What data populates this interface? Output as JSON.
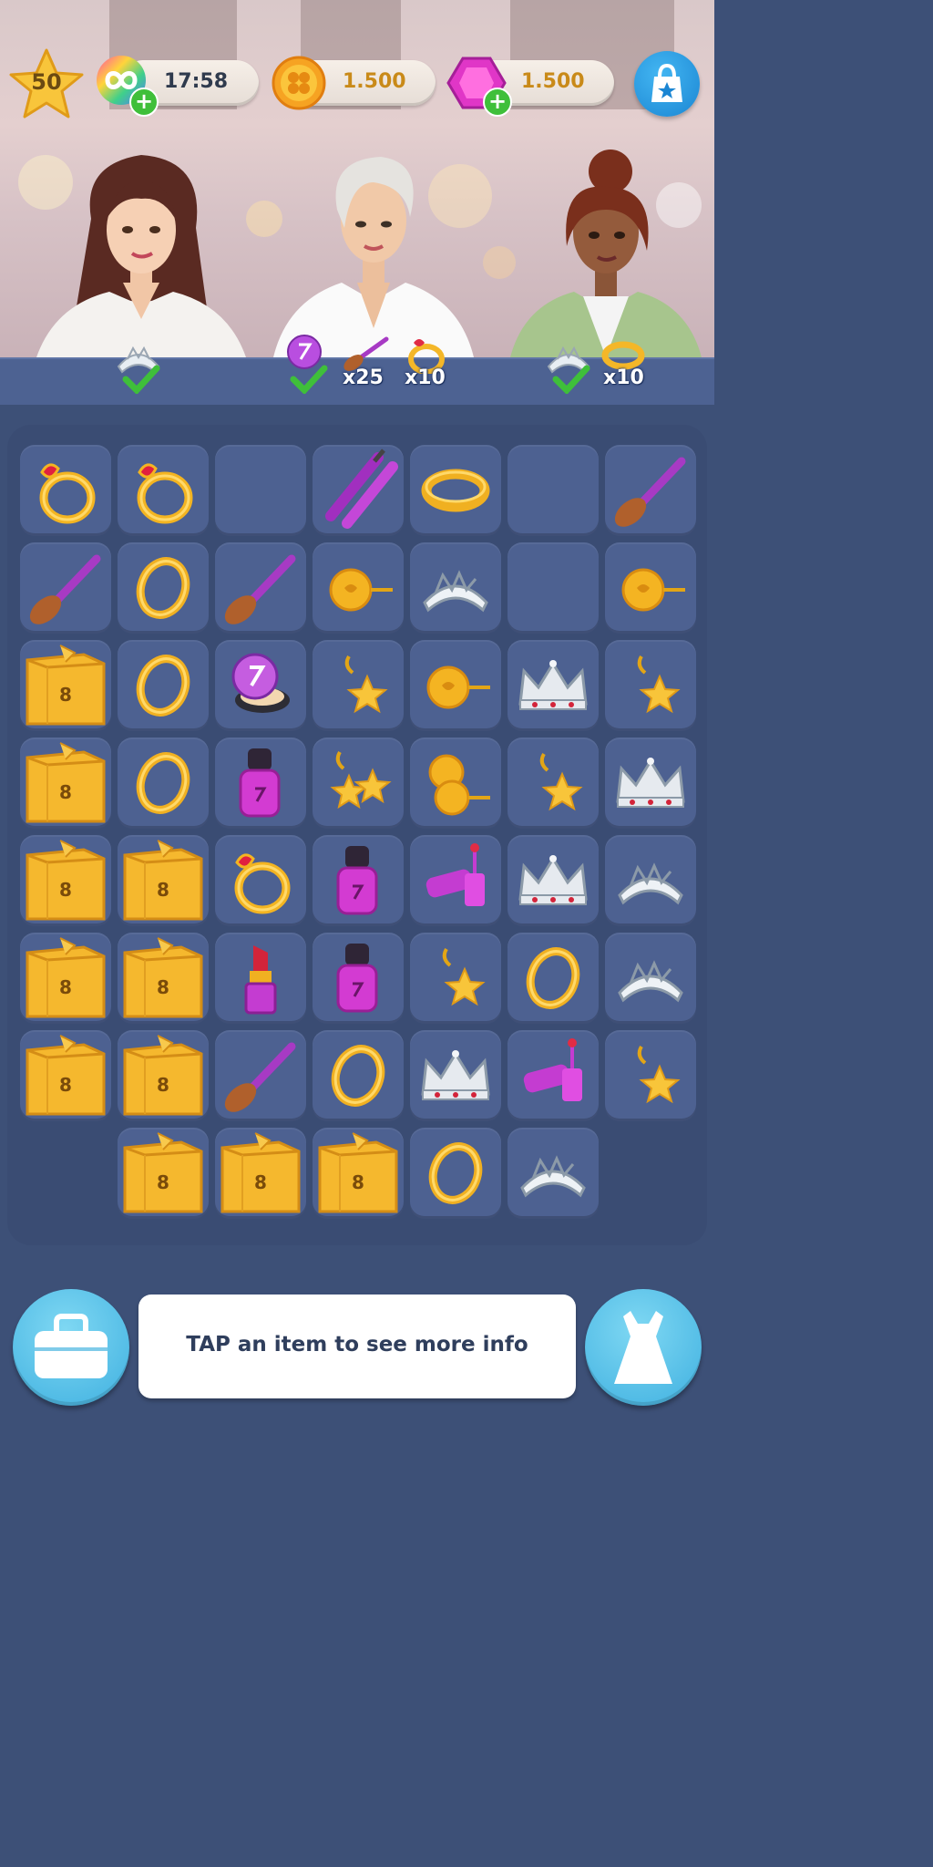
{
  "hud": {
    "level": "50",
    "energy_timer": "17:58",
    "coins": "1.500",
    "gems": "1.500",
    "icons": [
      "star-icon",
      "infinity-energy-icon",
      "plus-icon",
      "clover-coin-icon",
      "gem-icon",
      "shop-bag-icon"
    ]
  },
  "orders": {
    "customer_1": {
      "items": [
        "tiara"
      ],
      "status": "done"
    },
    "customer_2": {
      "items": [
        "compact",
        "brush",
        "ruby-ring"
      ],
      "status": "done",
      "qty_brush": "x25",
      "qty_ring": "x10"
    },
    "customer_3": {
      "items": [
        "tiara",
        "bangle"
      ],
      "status": "done",
      "qty_bangle": "x10"
    }
  },
  "board": {
    "rows": [
      [
        "ruby-ring",
        "ruby-ring",
        "empty",
        "mascara",
        "bangle",
        "empty",
        "brush"
      ],
      [
        "brush",
        "gold-ring",
        "brush",
        "stud-earring",
        "tiara",
        "empty",
        "stud-earring"
      ],
      [
        "box",
        "gold-ring",
        "compact",
        "star-earring",
        "stud-earring",
        "crown",
        "star-earring"
      ],
      [
        "box",
        "gold-ring",
        "nail-polish",
        "star-earring-pair",
        "stud-earring-pair",
        "star-earring",
        "crown"
      ],
      [
        "box",
        "box",
        "ruby-ring",
        "nail-polish",
        "lip-gloss",
        "crown",
        "tiara"
      ],
      [
        "box",
        "box",
        "lipstick",
        "nail-polish",
        "star-earring",
        "gold-ring",
        "tiara"
      ],
      [
        "box",
        "box",
        "brush",
        "gold-ring",
        "crown",
        "lip-gloss",
        "star-earring"
      ],
      [
        "none",
        "box",
        "box",
        "box",
        "gold-ring",
        "tiara",
        "none"
      ]
    ],
    "box_label": "8"
  },
  "footer": {
    "info_text": "TAP an item to see more info",
    "left_button_icon": "briefcase-icon",
    "right_button_icon": "dress-icon"
  },
  "colors": {
    "board_bg": "#3d5077",
    "tile": "#4d6191",
    "gold": "#f5b82e",
    "accent_blue": "#2f9de4"
  }
}
